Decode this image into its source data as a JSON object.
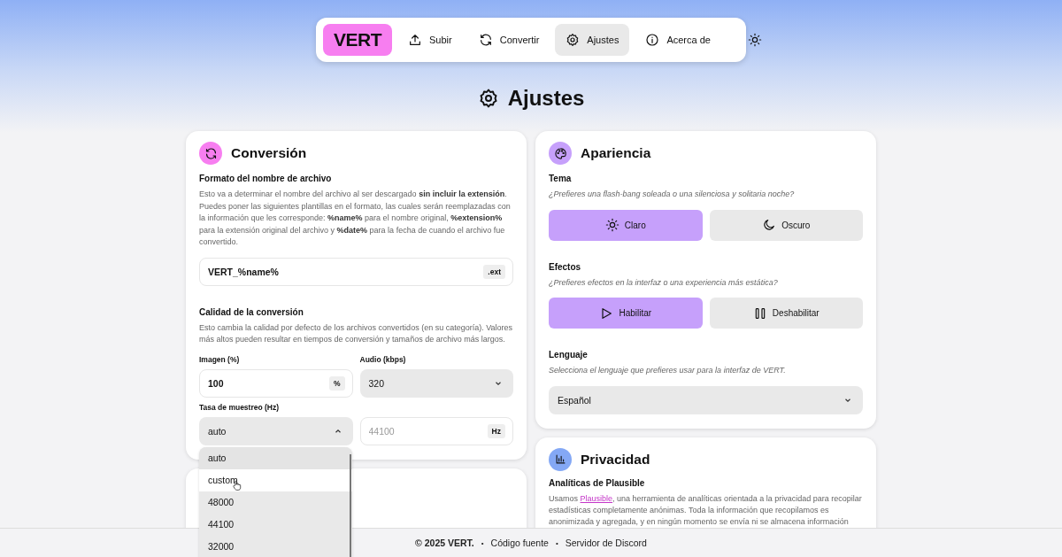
{
  "nav": {
    "logo": "VERT",
    "items": [
      {
        "label": "Subir",
        "kind": "upload",
        "selected": false
      },
      {
        "label": "Convertir",
        "kind": "refresh",
        "selected": false
      },
      {
        "label": "Ajustes",
        "kind": "gear",
        "selected": true
      },
      {
        "label": "Acerca de",
        "kind": "info",
        "selected": false
      }
    ]
  },
  "page_title": "Ajustes",
  "conversion": {
    "title": "Conversión",
    "filename": {
      "label": "Formato del nombre de archivo",
      "description": "Esto va a determinar el nombre del archivo al ser descargado **sin incluir la extensión**. Puedes poner las siguientes plantillas en el formato, las cuales serán reemplazadas con la información que les corresponde: **%name%** para el nombre original, **%extension%** para la extensión original del archivo y **%date%** para la fecha de cuando el archivo fue convertido.",
      "value": "VERT_%name%",
      "suffix": ".ext"
    },
    "quality": {
      "label": "Calidad de la conversión",
      "description": "Esto cambia la calidad por defecto de los archivos convertidos (en su categoría). Valores más altos pueden resultar en tiempos de conversión y tamaños de archivo más largos.",
      "image": {
        "label": "Imagen (%)",
        "value": "100",
        "suffix": "%"
      },
      "audio": {
        "label": "Audio (kbps)",
        "value": "320",
        "expanded": false
      },
      "sample_rate": {
        "label": "Tasa de muestreo (Hz)",
        "value": "auto",
        "expanded": true,
        "custom_placeholder": "44100",
        "custom_suffix": "Hz",
        "options": [
          {
            "label": "auto",
            "selected": true,
            "hovered": false
          },
          {
            "label": "custom",
            "selected": false,
            "hovered": true
          },
          {
            "label": "48000",
            "selected": false,
            "hovered": false
          },
          {
            "label": "44100",
            "selected": false,
            "hovered": false
          },
          {
            "label": "32000",
            "selected": false,
            "hovered": false
          }
        ]
      }
    }
  },
  "appearance": {
    "title": "Apariencia",
    "theme": {
      "label": "Tema",
      "description": "¿Prefieres una flash-bang soleada o una silenciosa y solitaria noche?",
      "options": [
        {
          "label": "Claro",
          "kind": "sun",
          "selected": true
        },
        {
          "label": "Oscuro",
          "kind": "moon",
          "selected": false
        }
      ]
    },
    "effects": {
      "label": "Efectos",
      "description": "¿Prefieres efectos en la interfaz o una experiencia más estática?",
      "options": [
        {
          "label": "Habilitar",
          "kind": "play",
          "selected": true
        },
        {
          "label": "Deshabilitar",
          "kind": "pause",
          "selected": false
        }
      ]
    },
    "language": {
      "label": "Lenguaje",
      "description": "Selecciona el lenguaje que prefieres usar para la interfaz de VERT.",
      "value": "Español"
    }
  },
  "privacy": {
    "title": "Privacidad",
    "label": "Analíticas de Plausible",
    "text_before": "Usamos",
    "link": "Plausible",
    "text_after": ", una herramienta de analíticas orientada a la privacidad para recopilar estadísticas completamente anónimas. Toda la información que recopilamos es anonimizada y agregada, y en ningún momento se envía ni se almacena información"
  },
  "footer": {
    "copyright": "© 2025 VERT.",
    "links": [
      "Código fuente",
      "Servidor de Discord"
    ],
    "separator": "•"
  }
}
